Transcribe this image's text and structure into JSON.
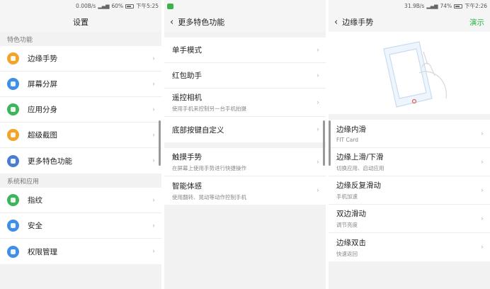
{
  "panel1": {
    "status": {
      "speed": "0.00B/s",
      "battery": "60%",
      "time": "下午5:25"
    },
    "title": "设置",
    "section1_label": "特色功能",
    "section1_items": [
      {
        "label": "边缘手势",
        "color": "#f3a32a",
        "icon": "gesture-icon"
      },
      {
        "label": "屏幕分屏",
        "color": "#3f8ee8",
        "icon": "split-screen-icon"
      },
      {
        "label": "应用分身",
        "color": "#3cb55b",
        "icon": "app-clone-icon"
      },
      {
        "label": "超级截图",
        "color": "#f3a32a",
        "icon": "screenshot-icon"
      },
      {
        "label": "更多特色功能",
        "color": "#4a7ccf",
        "icon": "more-icon"
      }
    ],
    "section2_label": "系统和应用",
    "section2_items": [
      {
        "label": "指纹",
        "color": "#3cb55b",
        "icon": "fingerprint-icon"
      },
      {
        "label": "安全",
        "color": "#3f8ee8",
        "icon": "shield-icon"
      },
      {
        "label": "权限管理",
        "color": "#3f8ee8",
        "icon": "permission-icon"
      }
    ]
  },
  "panel2": {
    "title": "更多特色功能",
    "group1": [
      {
        "label": "单手模式",
        "sub": ""
      },
      {
        "label": "红包助手",
        "sub": ""
      },
      {
        "label": "遥控相机",
        "sub": "使用手机来控制另一台手机拍摄"
      },
      {
        "label": "底部按键自定义",
        "sub": ""
      }
    ],
    "group2": [
      {
        "label": "触摸手势",
        "sub": "在屏幕上使用手势进行快捷操作"
      },
      {
        "label": "智能体感",
        "sub": "使用翻转、晃动等动作控制手机"
      }
    ]
  },
  "panel3": {
    "status": {
      "speed": "31.9B/s",
      "battery": "74%",
      "time": "下午2:26"
    },
    "title": "边缘手势",
    "action": "演示",
    "items": [
      {
        "label": "边缘内滑",
        "sub": "FIT Card"
      },
      {
        "label": "边缘上滑/下滑",
        "sub": "切换应用、启动应用"
      },
      {
        "label": "边缘反复滑动",
        "sub": "手机加速"
      },
      {
        "label": "双边滑动",
        "sub": "调节亮度"
      },
      {
        "label": "边缘双击",
        "sub": "快速返回"
      }
    ]
  }
}
